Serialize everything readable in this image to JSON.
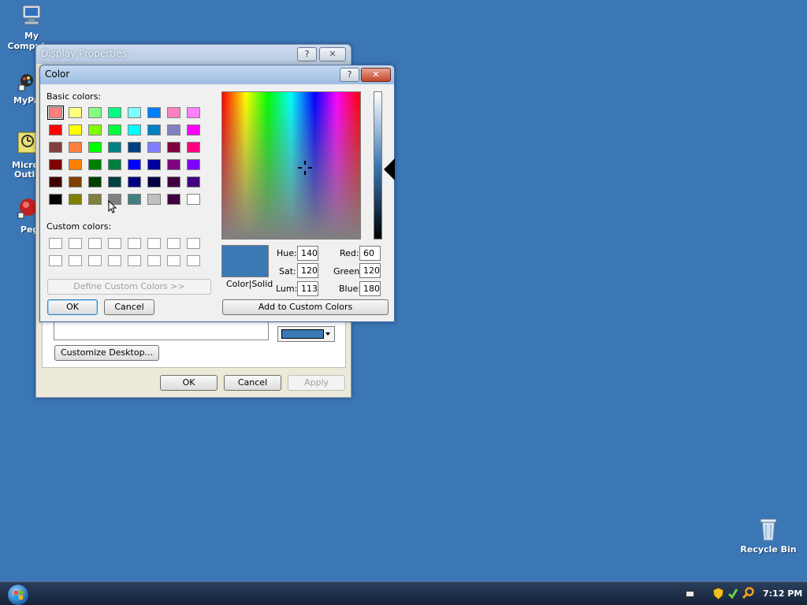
{
  "desktop": {
    "icons": {
      "my_computer": "My Computer",
      "mypaint_partial": "MyPa",
      "outlook_partial_1": "Micro",
      "outlook_partial_2": "Outlo",
      "pegasus_partial": "Peg",
      "recycle_bin": "Recycle Bin"
    }
  },
  "display_properties": {
    "title": "Display Properties",
    "help_glyph": "?",
    "close_glyph": "✕",
    "color_value_hex": "#3c78b4",
    "customize_label": "Customize Desktop...",
    "ok_label": "OK",
    "cancel_label": "Cancel",
    "apply_label": "Apply"
  },
  "color_dialog": {
    "title": "Color",
    "help_glyph": "?",
    "close_glyph": "✕",
    "basic_label": "Basic colors:",
    "custom_label": "Custom colors:",
    "define_label": "Define Custom Colors >>",
    "ok_label": "OK",
    "cancel_label": "Cancel",
    "add_label": "Add to Custom Colors",
    "color_solid_label": "Color|Solid",
    "hue_label": "Hue:",
    "sat_label": "Sat:",
    "lum_label": "Lum:",
    "red_label": "Red:",
    "green_label": "Green:",
    "blue_label": "Blue:",
    "hue": "140",
    "sat": "120",
    "lum": "113",
    "red": "60",
    "green": "120",
    "blue": "180",
    "preview_color": "#3c78b4",
    "basic_colors": [
      "#ff8080",
      "#ffff80",
      "#80ff80",
      "#00ff80",
      "#80ffff",
      "#0080ff",
      "#ff80c0",
      "#ff80ff",
      "#ff0000",
      "#ffff00",
      "#80ff00",
      "#00ff40",
      "#00ffff",
      "#0080c0",
      "#8080c0",
      "#ff00ff",
      "#804040",
      "#ff8040",
      "#00ff00",
      "#008080",
      "#004080",
      "#8080ff",
      "#800040",
      "#ff0080",
      "#800000",
      "#ff8000",
      "#008000",
      "#008040",
      "#0000ff",
      "#0000a0",
      "#800080",
      "#8000ff",
      "#400000",
      "#804000",
      "#004000",
      "#004040",
      "#000080",
      "#000040",
      "#400040",
      "#400080",
      "#000000",
      "#808000",
      "#808040",
      "#808080",
      "#408080",
      "#c0c0c0",
      "#400040",
      "#ffffff"
    ]
  },
  "taskbar": {
    "start_label": "Start",
    "clock": "7:12 PM"
  }
}
